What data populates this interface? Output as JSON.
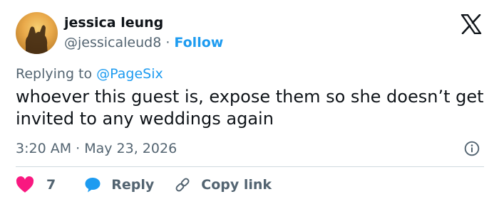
{
  "author": {
    "name": "jessica leung",
    "handle": "@jessicaleud8",
    "separator": " · ",
    "follow_label": "Follow"
  },
  "reply_context": {
    "prefix": "Replying to ",
    "mention": "@PageSix"
  },
  "tweet": {
    "text": "whoever this guest is, expose them so she doesn’t get invited to any weddings again",
    "time": "3:20 AM",
    "date_separator": " · ",
    "date": "May 23, 2026"
  },
  "actions": {
    "like_count": "7",
    "reply_label": "Reply",
    "copy_link_label": "Copy link"
  },
  "icons": {
    "logo": "x-logo-icon",
    "info": "info-icon",
    "like": "heart-icon",
    "reply": "speech-bubble-icon",
    "copy_link": "link-icon"
  },
  "colors": {
    "text": "#0f1419",
    "secondary": "#536471",
    "accent": "#1d9bf0",
    "like": "#f91880",
    "divider": "#cfd9de"
  }
}
